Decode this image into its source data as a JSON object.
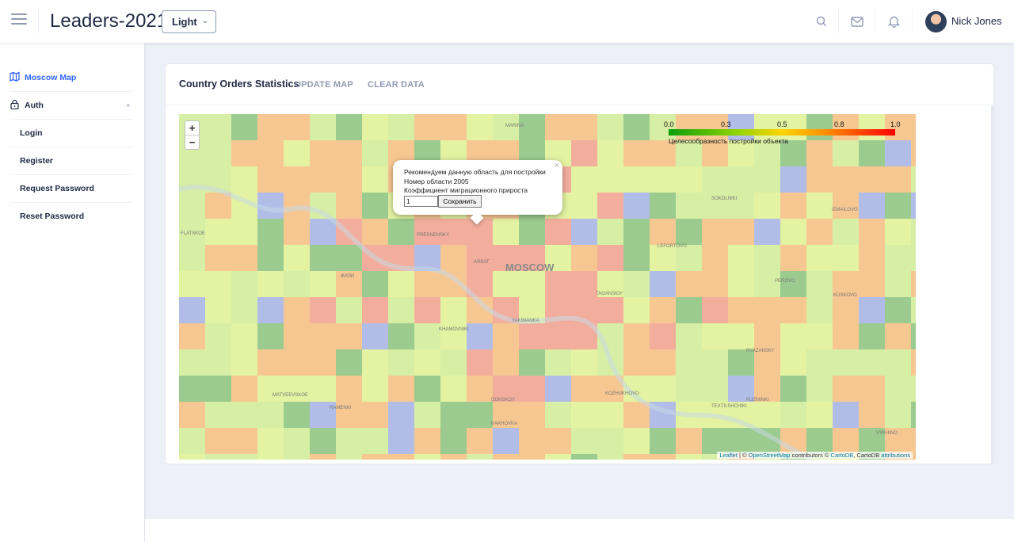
{
  "header": {
    "title": "Leaders-2021",
    "theme_select": "Light",
    "user_name": "Nick Jones",
    "icons": [
      "menu-icon",
      "search-icon",
      "email-icon",
      "bell-icon"
    ]
  },
  "sidebar": {
    "items": [
      {
        "label": "Moscow Map",
        "icon": "map-icon",
        "active": true
      },
      {
        "label": "Auth",
        "icon": "lock-icon",
        "expandable": true
      },
      {
        "label": "Login"
      },
      {
        "label": "Register"
      },
      {
        "label": "Request Password"
      },
      {
        "label": "Reset Password"
      }
    ]
  },
  "card": {
    "title": "Country Orders Statistics",
    "update_btn": "UPDATE MAP",
    "clear_btn": "CLEAR DATA"
  },
  "map": {
    "zoom_in": "+",
    "zoom_out": "−",
    "legend": {
      "ticks": [
        "0.0",
        "0.3",
        "0.5",
        "0.8",
        "1.0"
      ],
      "caption": "Целесообразность постройки объекта",
      "colors": [
        "#0a9d0a",
        "#8fd400",
        "#ffd400",
        "#ff8c00",
        "#ff0000"
      ]
    },
    "popup": {
      "line1": "Рекомендуем данную область для постройки",
      "line2": "Номер области 2005",
      "line3": "Коэффициент миграционного прироста",
      "input_value": "1",
      "save_btn": "Сохранить",
      "close": "×"
    },
    "labels": {
      "moscow": "MOSCOW",
      "presnensky": "PRESNENSKY",
      "arbat": "ARBAT",
      "khamovniki": "KHAMOVNIKI",
      "taganskiy": "TAGANSKIY",
      "lefortovo": "LEFORTOVO",
      "ryazansky": "RYAZANSKY",
      "kuzminki": "KUZMINKI",
      "donskoy": "DONSKOY",
      "yakimanka": "YAKIMANKA",
      "filevsky": "ФИЛИ",
      "krylatskoe": "FLATSKOE",
      "matveevskoe": "MATVEEVSKOE",
      "ramenki": "RAMENKI",
      "perovo": "PEROVO",
      "kuskovo": "KUSKOVO",
      "marina": "MARINA",
      "sokolniki": "SOKOLNIKI",
      "izmailovo": "IZMAILOVO",
      "textilshchiki": "TEXTILSHCHIKI",
      "vykhino": "VYKHINO",
      "kozhukhovo": "KOZHUKHOVO",
      "kakhovka": "KAKHOVKA"
    },
    "attribution": {
      "leaflet": "Leaflet",
      "sep1": " | © ",
      "osm": "OpenStreetMap",
      "sep2": " contributors © ",
      "cartodb": "CartoDB",
      "sep3": ", CartoDB ",
      "attributions": "attributions"
    }
  }
}
